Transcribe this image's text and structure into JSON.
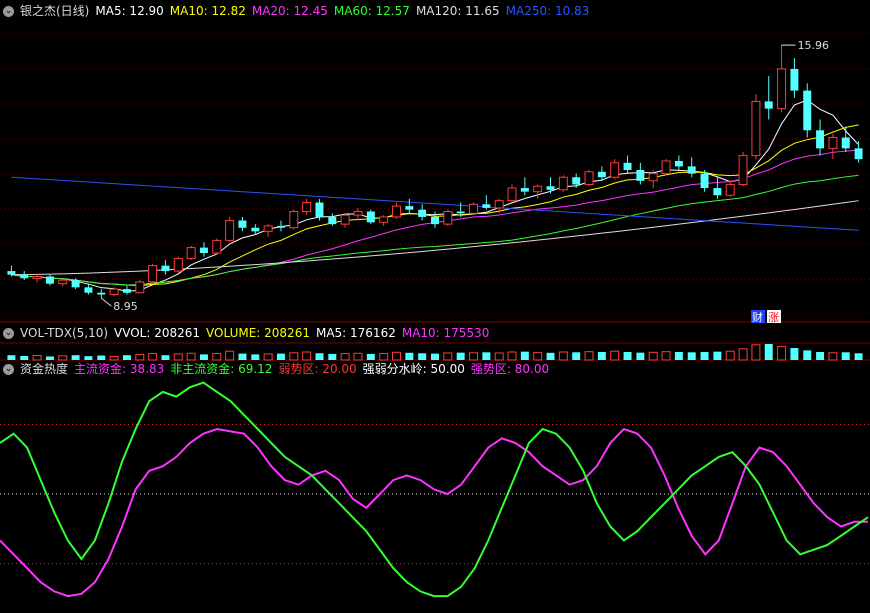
{
  "price_legend": {
    "title": "银之杰(日线)",
    "items": [
      {
        "label": "MA5: 12.90",
        "color": "#ffffff"
      },
      {
        "label": "MA10: 12.82",
        "color": "#ffff00"
      },
      {
        "label": "MA20: 12.45",
        "color": "#ff33ff"
      },
      {
        "label": "MA60: 12.57",
        "color": "#33ff33"
      },
      {
        "label": "MA120: 11.65",
        "color": "#dddddd"
      },
      {
        "label": "MA250: 10.83",
        "color": "#2a52ff"
      }
    ]
  },
  "volume_legend": {
    "title": "VOL-TDX(5,10)",
    "items": [
      {
        "label": "VVOL: 208261",
        "color": "#ffffff"
      },
      {
        "label": "VOLUME: 208261",
        "color": "#ffff00"
      },
      {
        "label": "MA5: 176162",
        "color": "#ffffff"
      },
      {
        "label": "MA10: 175530",
        "color": "#ff33ff"
      }
    ]
  },
  "indicator_legend": {
    "title": "资金热度",
    "items": [
      {
        "label": "主流资金: 38.83",
        "color": "#ff33ff"
      },
      {
        "label": "非主流资金: 69.12",
        "color": "#33ff33"
      },
      {
        "label": "弱势区: 20.00",
        "color": "#ff3333"
      },
      {
        "label": "强弱分水岭: 50.00",
        "color": "#ffffff"
      },
      {
        "label": "强势区: 80.00",
        "color": "#ff33ff"
      }
    ]
  },
  "markers": {
    "high_label": "15.96",
    "low_label": "8.95",
    "badge_left": "财",
    "badge_right": "涨"
  },
  "chart_data": {
    "type": "candlestick",
    "price_range": [
      8.4,
      16.6
    ],
    "high": 15.96,
    "low": 8.95,
    "ohlc": [
      [
        9.7,
        9.85,
        9.55,
        9.6
      ],
      [
        9.6,
        9.7,
        9.45,
        9.5
      ],
      [
        9.5,
        9.62,
        9.38,
        9.55
      ],
      [
        9.55,
        9.6,
        9.3,
        9.35
      ],
      [
        9.35,
        9.5,
        9.28,
        9.45
      ],
      [
        9.45,
        9.5,
        9.2,
        9.25
      ],
      [
        9.25,
        9.35,
        9.05,
        9.1
      ],
      [
        9.1,
        9.2,
        8.95,
        9.05
      ],
      [
        9.05,
        9.25,
        9.0,
        9.2
      ],
      [
        9.2,
        9.3,
        9.05,
        9.1
      ],
      [
        9.1,
        9.45,
        9.08,
        9.4
      ],
      [
        9.4,
        9.9,
        9.35,
        9.85
      ],
      [
        9.85,
        10.0,
        9.6,
        9.7
      ],
      [
        9.7,
        10.1,
        9.65,
        10.05
      ],
      [
        10.05,
        10.4,
        10.0,
        10.35
      ],
      [
        10.35,
        10.5,
        10.1,
        10.2
      ],
      [
        10.2,
        10.6,
        10.15,
        10.55
      ],
      [
        10.55,
        11.2,
        10.5,
        11.1
      ],
      [
        11.1,
        11.2,
        10.8,
        10.9
      ],
      [
        10.9,
        11.0,
        10.7,
        10.8
      ],
      [
        10.8,
        11.0,
        10.65,
        10.95
      ],
      [
        10.95,
        11.1,
        10.8,
        10.9
      ],
      [
        10.9,
        11.4,
        10.85,
        11.35
      ],
      [
        11.35,
        11.7,
        11.25,
        11.6
      ],
      [
        11.6,
        11.7,
        11.1,
        11.2
      ],
      [
        11.2,
        11.3,
        10.95,
        11.0
      ],
      [
        11.0,
        11.3,
        10.9,
        11.25
      ],
      [
        11.25,
        11.45,
        11.1,
        11.35
      ],
      [
        11.35,
        11.4,
        11.0,
        11.05
      ],
      [
        11.05,
        11.25,
        10.95,
        11.2
      ],
      [
        11.2,
        11.6,
        11.15,
        11.5
      ],
      [
        11.5,
        11.7,
        11.3,
        11.4
      ],
      [
        11.4,
        11.55,
        11.1,
        11.2
      ],
      [
        11.2,
        11.35,
        10.9,
        11.0
      ],
      [
        11.0,
        11.4,
        10.95,
        11.35
      ],
      [
        11.35,
        11.6,
        11.2,
        11.3
      ],
      [
        11.3,
        11.6,
        11.25,
        11.55
      ],
      [
        11.55,
        11.8,
        11.4,
        11.45
      ],
      [
        11.45,
        11.7,
        11.3,
        11.65
      ],
      [
        11.65,
        12.1,
        11.6,
        12.0
      ],
      [
        12.0,
        12.3,
        11.8,
        11.9
      ],
      [
        11.9,
        12.1,
        11.7,
        12.05
      ],
      [
        12.05,
        12.3,
        11.85,
        11.95
      ],
      [
        11.95,
        12.35,
        11.9,
        12.3
      ],
      [
        12.3,
        12.4,
        12.0,
        12.1
      ],
      [
        12.1,
        12.5,
        12.05,
        12.45
      ],
      [
        12.45,
        12.6,
        12.2,
        12.3
      ],
      [
        12.3,
        12.8,
        12.25,
        12.7
      ],
      [
        12.7,
        12.9,
        12.4,
        12.5
      ],
      [
        12.5,
        12.7,
        12.1,
        12.2
      ],
      [
        12.2,
        12.5,
        12.0,
        12.4
      ],
      [
        12.4,
        12.8,
        12.35,
        12.75
      ],
      [
        12.75,
        12.9,
        12.5,
        12.6
      ],
      [
        12.6,
        12.85,
        12.3,
        12.4
      ],
      [
        12.4,
        12.5,
        11.9,
        12.0
      ],
      [
        12.0,
        12.3,
        11.7,
        11.8
      ],
      [
        11.8,
        12.2,
        11.75,
        12.1
      ],
      [
        12.1,
        13.0,
        12.05,
        12.9
      ],
      [
        12.9,
        14.6,
        12.8,
        14.4
      ],
      [
        14.4,
        15.1,
        13.9,
        14.2
      ],
      [
        14.2,
        15.96,
        14.1,
        15.3
      ],
      [
        15.3,
        15.6,
        14.5,
        14.7
      ],
      [
        14.7,
        14.9,
        13.4,
        13.6
      ],
      [
        13.6,
        13.9,
        12.9,
        13.1
      ],
      [
        13.1,
        13.5,
        12.8,
        13.4
      ],
      [
        13.4,
        13.7,
        13.0,
        13.1
      ],
      [
        13.1,
        13.3,
        12.7,
        12.8
      ]
    ],
    "ma_end_values": {
      "MA5": 12.9,
      "MA10": 12.82,
      "MA20": 12.45,
      "MA60": 12.57,
      "MA120": 11.65,
      "MA250": 10.83
    },
    "indicator": {
      "range": [
        0,
        100
      ],
      "levels": [
        20,
        50,
        80
      ],
      "series": [
        {
          "name": "主流资金",
          "color": "#ff33ff",
          "values": [
            30,
            24,
            18,
            12,
            8,
            6,
            7,
            12,
            22,
            36,
            52,
            60,
            62,
            66,
            72,
            76,
            78,
            77,
            76,
            70,
            62,
            56,
            54,
            58,
            60,
            56,
            48,
            44,
            50,
            56,
            58,
            56,
            52,
            50,
            54,
            62,
            70,
            74,
            72,
            68,
            62,
            58,
            54,
            56,
            62,
            72,
            78,
            76,
            70,
            58,
            44,
            32,
            24,
            30,
            46,
            62,
            70,
            68,
            62,
            54,
            46,
            40,
            36,
            38,
            38
          ]
        },
        {
          "name": "非主流资金",
          "color": "#33ff33",
          "values": [
            72,
            76,
            70,
            56,
            42,
            30,
            22,
            30,
            46,
            64,
            78,
            90,
            94,
            92,
            96,
            98,
            94,
            90,
            84,
            78,
            72,
            66,
            62,
            58,
            52,
            46,
            40,
            34,
            26,
            18,
            12,
            8,
            6,
            6,
            10,
            18,
            30,
            44,
            58,
            72,
            78,
            76,
            70,
            60,
            46,
            36,
            30,
            34,
            40,
            46,
            52,
            58,
            62,
            66,
            68,
            62,
            54,
            42,
            30,
            24,
            26,
            28,
            32,
            36,
            40
          ]
        }
      ]
    },
    "volume": [
      0.3,
      0.25,
      0.28,
      0.22,
      0.26,
      0.3,
      0.24,
      0.28,
      0.22,
      0.3,
      0.35,
      0.4,
      0.3,
      0.38,
      0.42,
      0.35,
      0.4,
      0.55,
      0.4,
      0.35,
      0.38,
      0.4,
      0.45,
      0.5,
      0.42,
      0.38,
      0.4,
      0.42,
      0.38,
      0.4,
      0.48,
      0.45,
      0.42,
      0.4,
      0.44,
      0.46,
      0.45,
      0.48,
      0.44,
      0.5,
      0.52,
      0.46,
      0.45,
      0.5,
      0.48,
      0.52,
      0.5,
      0.55,
      0.5,
      0.46,
      0.48,
      0.52,
      0.5,
      0.48,
      0.5,
      0.52,
      0.55,
      0.7,
      0.95,
      1.0,
      0.85,
      0.75,
      0.6,
      0.5,
      0.45,
      0.48,
      0.42
    ]
  }
}
